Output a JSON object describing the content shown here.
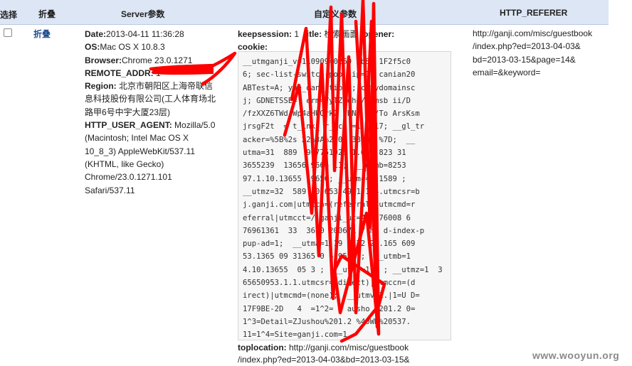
{
  "header": {
    "col_select": "选择",
    "col_fold": "折叠",
    "col_server": "Server参数",
    "col_custom": "自定义参数",
    "col_referer": "HTTP_REFERER"
  },
  "row": {
    "fold_link": "折叠",
    "checked": false,
    "server": {
      "date_label": "Date:",
      "date_value": "2013-04-11 11:36:28",
      "os_label": "OS:",
      "os_value": "Mac OS X 10.8.3",
      "browser_label": "Browser:",
      "browser_value": "Chrome 23.0.1271",
      "remote_addr_label": "REMOTE_ADDR:",
      "remote_addr_value": "1",
      "region_label": "Region:",
      "region_lines": [
        "北京市朝阳区上海帝联信",
        "息科技股份有限公司(工人体育场北",
        "路甲6号中宇大厦23层)"
      ],
      "ua_label": "HTTP_USER_AGENT:",
      "ua_lines": [
        " Mozilla/5.0",
        "(Macintosh; Intel Mac OS X",
        "10_8_3) AppleWebKit/537.11",
        "(KHTML, like Gecko)",
        "Chrome/23.0.1271.101",
        "Safari/537.11"
      ]
    },
    "custom": {
      "keepsession_label": "keepsession:",
      "keepsession_value": "1",
      "title_label": "title:",
      "title_value": "检索画面",
      "opener_label": "opener:",
      "cookie_label": "cookie:",
      "cookie_lines": [
        "__utmganji_v=110909=0260 7b88 1F2f5c0",
        "6; sec-list-switch-pop tip=1; canian20",
        "ABTest=A; yue_dang_tip=1; citydomainsc",
        "j; GDNETSSE=  erm=VyTZ2dhe/ /msb ii/D",
        "/fzXXZ6TWd Wp4aHUQrk2 5bNr /6/To ArsKsm",
        "jrsgF2t  = t_ink_ r_acc =1 1917; __gl_tr",
        "acker=%5B%2s 22%3A%2106 38931 %7D;  __",
        "utma=31  889  907751923 1.636 823 31",
        "3655239  13656 9666 11;  __utmb=8253",
        "97.1.10.13655  9656; __utmc=2 1589 ;",
        "__utmz=32  589  0 653 4941.1.4.utmcsr=b",
        "j.ganji.com|utmccn=(referral)|utmcmd=r",
        "eferral|utmcct=/ ganji_ut=493 76008 6",
        "76961361  33  3680 200671 7 he d-index-p",
        "pup-ad=1;  __utma=1 19 8172 21.165 609",
        "53.1365 09 31365 0 6 953.1;  __utmb=1",
        "4.10.13655  05 3 ;  __utmc=1 6 ; __utmz=1  3",
        "65650953.1.1.utmcsr=(direct)|utmccn=(d",
        "irect)|utmcmd=(none);  __utmv=1.|1=U D=",
        "17F9BE-2D   4  =1^2=   ausho  201.2 0=",
        "1^3=Detail=ZJushou%201.2 %40WK%20537.",
        "11=1^4=Site=ganji.com=1"
      ]
    },
    "toplocation": {
      "label": "toplocation:",
      "lines": [
        "http://ganji.com/misc/guestbook",
        "/index.php?ed=2013-04-03&bd=2013-03-15&"
      ]
    },
    "referer_lines": [
      "http://ganji.com/misc/guestbook",
      "/index.php?ed=2013-04-03&",
      "bd=2013-03-15&page=14&",
      "email=&keyword="
    ]
  },
  "watermark": "www.wooyun.org",
  "colors": {
    "header_bg": "#dce6f4",
    "link": "#1f4e8f",
    "scribble": "#ff0000"
  }
}
